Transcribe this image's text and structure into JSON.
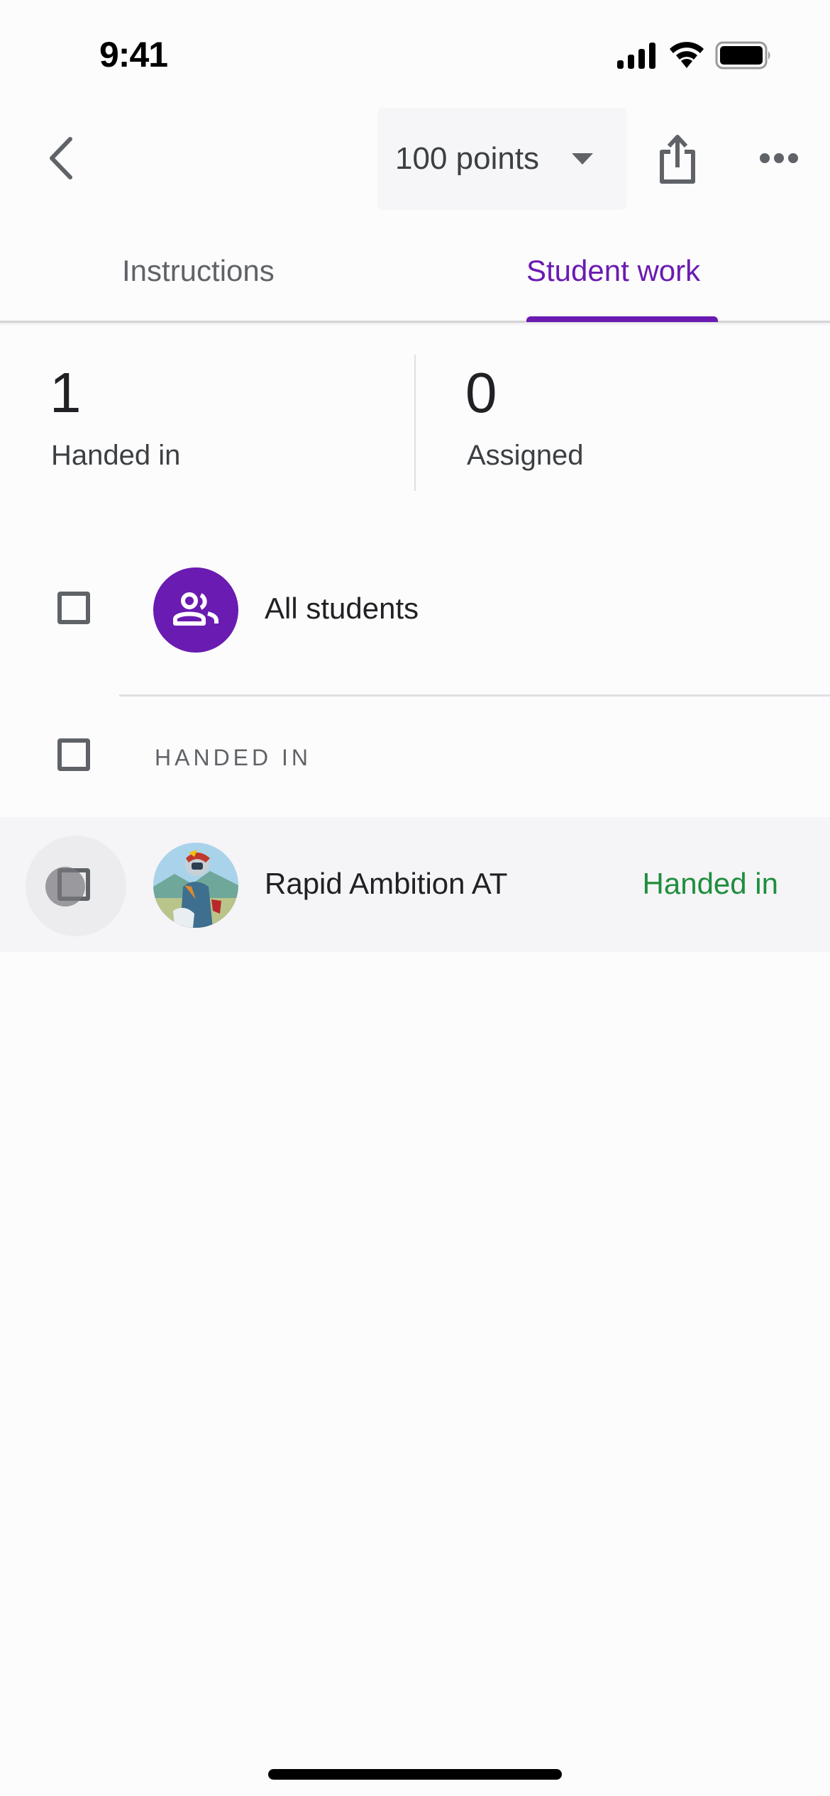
{
  "status_bar": {
    "time": "9:41",
    "icons": [
      "cellular-signal-icon",
      "wifi-icon",
      "battery-icon"
    ]
  },
  "top_bar": {
    "back_icon": "chevron-left-icon",
    "points_dropdown": {
      "value": "100 points",
      "icon": "caret-down-icon"
    },
    "share_icon": "share-icon",
    "more_icon": "more-horizontal-icon"
  },
  "tabs": [
    {
      "label": "Instructions",
      "active": false
    },
    {
      "label": "Student work",
      "active": true
    }
  ],
  "stats": [
    {
      "value": "1",
      "label": "Handed in"
    },
    {
      "value": "0",
      "label": "Assigned"
    }
  ],
  "list": {
    "all_students": {
      "label": "All students",
      "icon": "group-icon"
    },
    "section_header": "HANDED IN",
    "students": [
      {
        "name": "Rapid Ambition AT",
        "status": "Handed in",
        "avatar": "motocross-rider-avatar"
      }
    ]
  },
  "colors": {
    "accent": "#6a1bb1",
    "status_handed_in": "#1e8e3e",
    "text_primary": "#202124",
    "text_secondary": "#5f6368",
    "dropdown_bg": "#f6f6f8",
    "selected_row_bg": "#f5f4f6"
  }
}
